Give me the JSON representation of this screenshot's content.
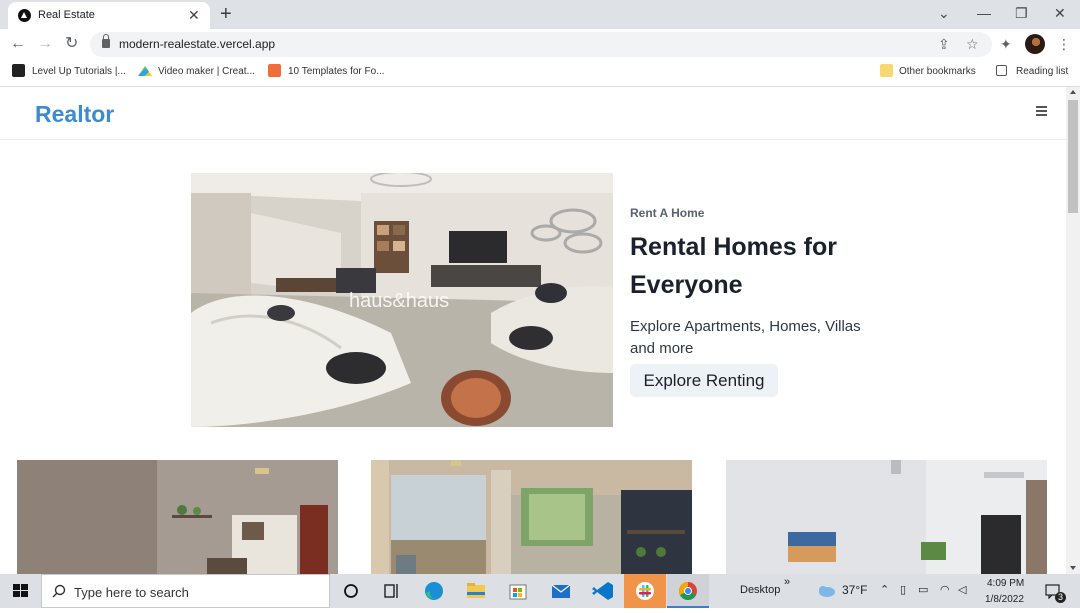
{
  "browser": {
    "tab_title": "Real Estate",
    "url": "modern-realestate.vercel.app",
    "bookmarks": [
      "Level Up Tutorials |...",
      "Video maker | Creat...",
      "10 Templates for Fo..."
    ],
    "other_bookmarks": "Other bookmarks",
    "reading_list": "Reading list"
  },
  "site": {
    "logo": "Realtor",
    "hero": {
      "eyebrow": "Rent A Home",
      "title": "Rental Homes for Everyone",
      "description": "Explore Apartments, Homes, Villas and more",
      "cta": "Explore Renting",
      "watermark": "haus&haus"
    }
  },
  "taskbar": {
    "search_placeholder": "Type here to search",
    "desktop": "Desktop",
    "temperature": "37°F",
    "time": "4:09 PM",
    "date": "1/8/2022",
    "notifications": "3"
  },
  "colors": {
    "brand": "#3d8bd0",
    "cta_bg": "#edf2f7",
    "tab_strip": "#dee1e6",
    "taskbar": "#dcdfe3"
  }
}
